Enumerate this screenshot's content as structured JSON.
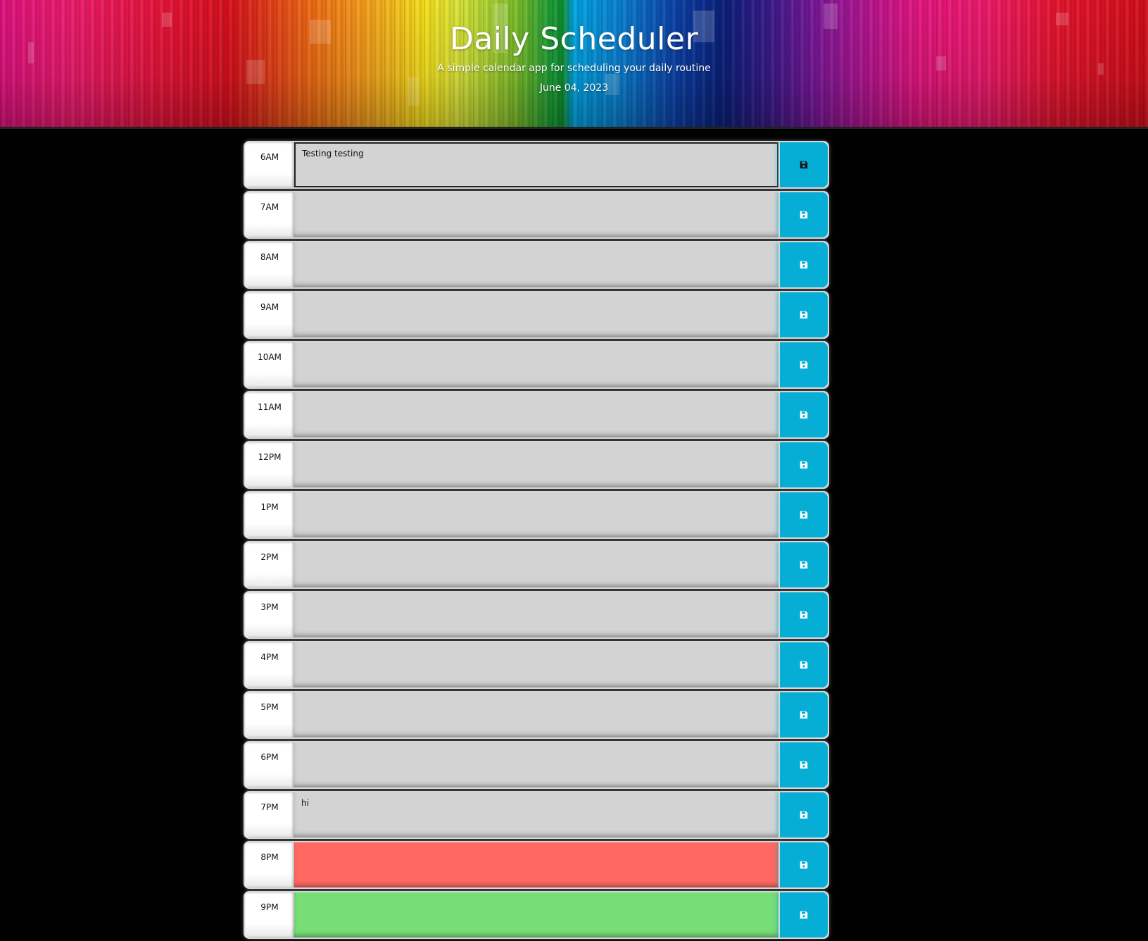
{
  "header": {
    "title": "Daily Scheduler",
    "lead": "A simple calendar app for scheduling your daily routine",
    "date": "June 04, 2023"
  },
  "colors": {
    "past": "#d3d3d3",
    "present": "#ff6961",
    "future": "#77dd77",
    "save_button": "#06aed5"
  },
  "save_icon": "floppy-disk-icon",
  "hours": [
    {
      "label": "6AM",
      "text": "Testing testing",
      "state": "past",
      "active": true
    },
    {
      "label": "7AM",
      "text": "",
      "state": "past"
    },
    {
      "label": "8AM",
      "text": "",
      "state": "past"
    },
    {
      "label": "9AM",
      "text": "",
      "state": "past"
    },
    {
      "label": "10AM",
      "text": "",
      "state": "past"
    },
    {
      "label": "11AM",
      "text": "",
      "state": "past"
    },
    {
      "label": "12PM",
      "text": "",
      "state": "past"
    },
    {
      "label": "1PM",
      "text": "",
      "state": "past"
    },
    {
      "label": "2PM",
      "text": "",
      "state": "past"
    },
    {
      "label": "3PM",
      "text": "",
      "state": "past"
    },
    {
      "label": "4PM",
      "text": "",
      "state": "past"
    },
    {
      "label": "5PM",
      "text": "",
      "state": "past"
    },
    {
      "label": "6PM",
      "text": "",
      "state": "past"
    },
    {
      "label": "7PM",
      "text": "hi",
      "state": "past"
    },
    {
      "label": "8PM",
      "text": "",
      "state": "present"
    },
    {
      "label": "9PM",
      "text": "",
      "state": "future"
    }
  ]
}
